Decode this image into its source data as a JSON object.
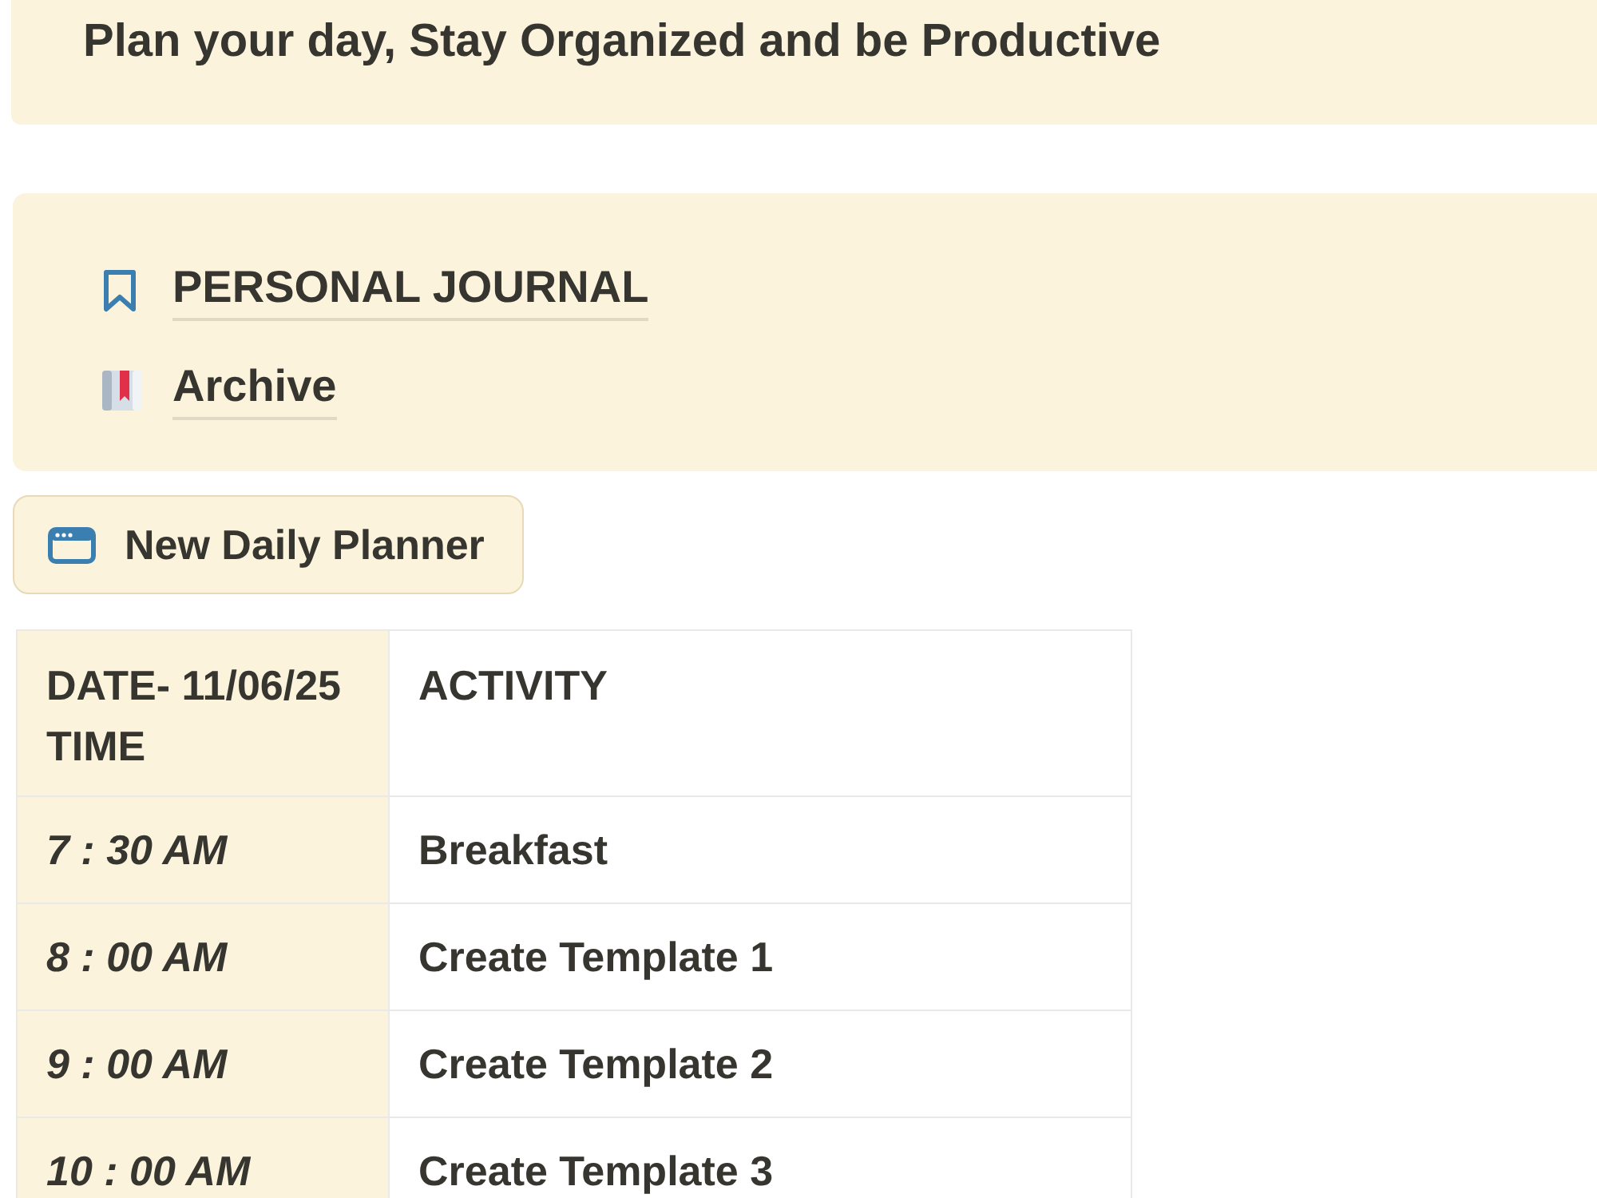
{
  "banner": {
    "text": "Plan your day, Stay Organized and be Productive"
  },
  "links": [
    {
      "label": "PERSONAL JOURNAL"
    },
    {
      "label": "Archive"
    }
  ],
  "new_button": {
    "label": "New Daily Planner"
  },
  "table": {
    "columns": [
      "DATE- 11/06/25 TIME",
      "ACTIVITY"
    ],
    "rows": [
      [
        "7 : 30 AM",
        "Breakfast"
      ],
      [
        "8 : 00 AM",
        "Create Template 1"
      ],
      [
        "9 : 00 AM",
        "Create Template 2"
      ],
      [
        "10 : 00 AM",
        "Create Template 3"
      ]
    ]
  }
}
